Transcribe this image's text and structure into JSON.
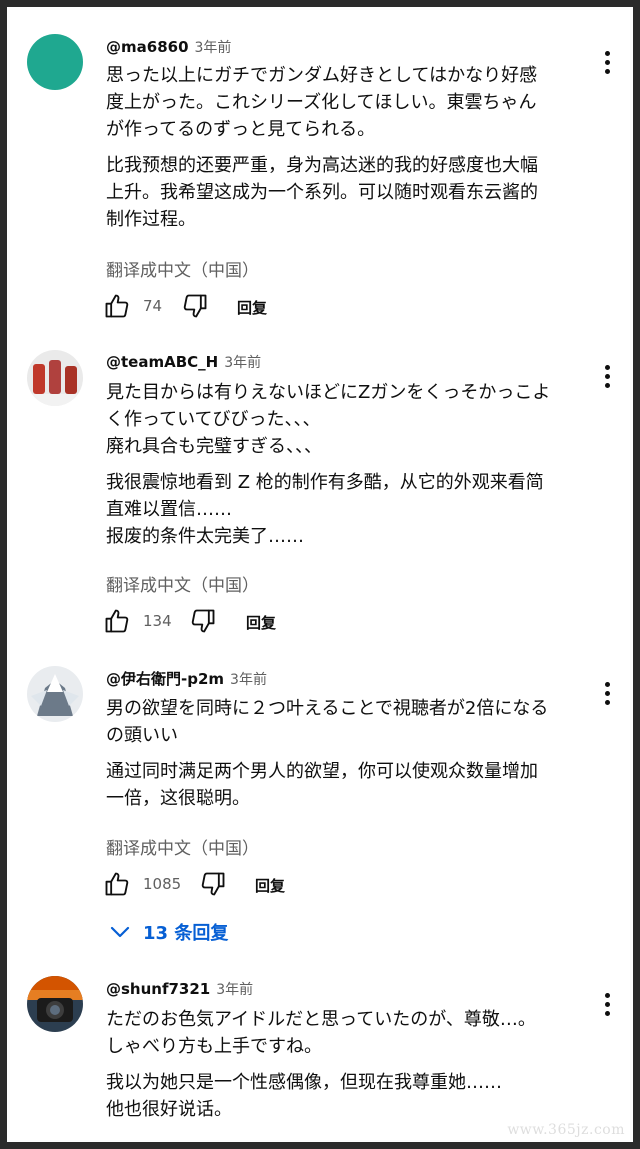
{
  "comments": [
    {
      "author": "@ma6860",
      "time": "3年前",
      "lines": [
        "思った以上にガチでガンダム好きとしてはかなり好感",
        "度上がった。これシリーズ化してほしい。東雲ちゃん",
        "が作ってるのずっと見てられる。"
      ],
      "translation": [
        "比我预想的还要严重，身为高达迷的我的好感度也大幅",
        "上升。我希望这成为一个系列。可以随时观看东云酱的",
        "制作过程。"
      ],
      "translate_label": "翻译成中文（中国）",
      "likes": "74",
      "reply_label": "回复",
      "avatar_color": "#1fa890"
    },
    {
      "author": "@teamABC_H",
      "time": "3年前",
      "lines": [
        "見た目からは有りえないほどにZガンをくっそかっこよ",
        "く作っていてびびった、、、",
        "廃れ具合も完璧すぎる、、、"
      ],
      "translation": [
        "我很震惊地看到 Z 枪的制作有多酷，从它的外观来看简",
        "直难以置信……",
        "报废的条件太完美了……"
      ],
      "translate_label": "翻译成中文（中国）",
      "likes": "134",
      "reply_label": "回复"
    },
    {
      "author": "@伊右衛門-p2m",
      "time": "3年前",
      "lines": [
        "男の欲望を同時に２つ叶えることで視聴者が2倍になる",
        "の頭いい"
      ],
      "translation": [
        "通过同时满足两个男人的欲望，你可以使观众数量增加",
        "一倍，这很聪明。"
      ],
      "translate_label": "翻译成中文（中国）",
      "likes": "1085",
      "reply_label": "回复",
      "replies_label": "13 条回复"
    },
    {
      "author": "@shunf7321",
      "time": "3年前",
      "lines": [
        "ただのお色気アイドルだと思っていたのが、尊敬…。",
        "しゃべり方も上手ですね。"
      ],
      "translation": [
        "我以为她只是一个性感偶像，但现在我尊重她……",
        "他也很好说话。"
      ]
    }
  ],
  "watermark": "www.365jz.com",
  "colors": {
    "accent": "#065fd4",
    "text": "#0f0f0f",
    "secondary": "#606060"
  }
}
